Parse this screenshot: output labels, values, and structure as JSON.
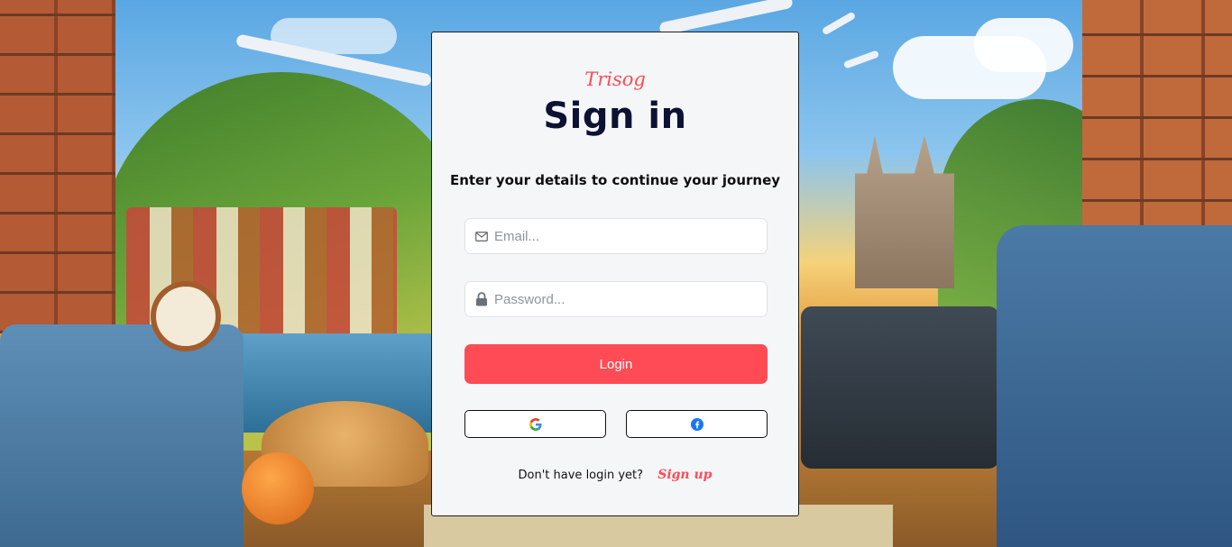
{
  "brand": {
    "name": "Trisog",
    "accent_color": "#ff4b55"
  },
  "signin": {
    "title": "Sign in",
    "subtitle": "Enter your details to continue your journey",
    "email": {
      "placeholder": "Email...",
      "value": "",
      "icon": "envelope-icon"
    },
    "password": {
      "placeholder": "Password...",
      "value": "",
      "icon": "lock-icon"
    },
    "login_label": "Login",
    "social": [
      {
        "provider": "google",
        "icon": "google-icon"
      },
      {
        "provider": "facebook",
        "icon": "facebook-icon"
      }
    ],
    "footer_text": "Don't have login yet?",
    "signup_label": "Sign up"
  }
}
